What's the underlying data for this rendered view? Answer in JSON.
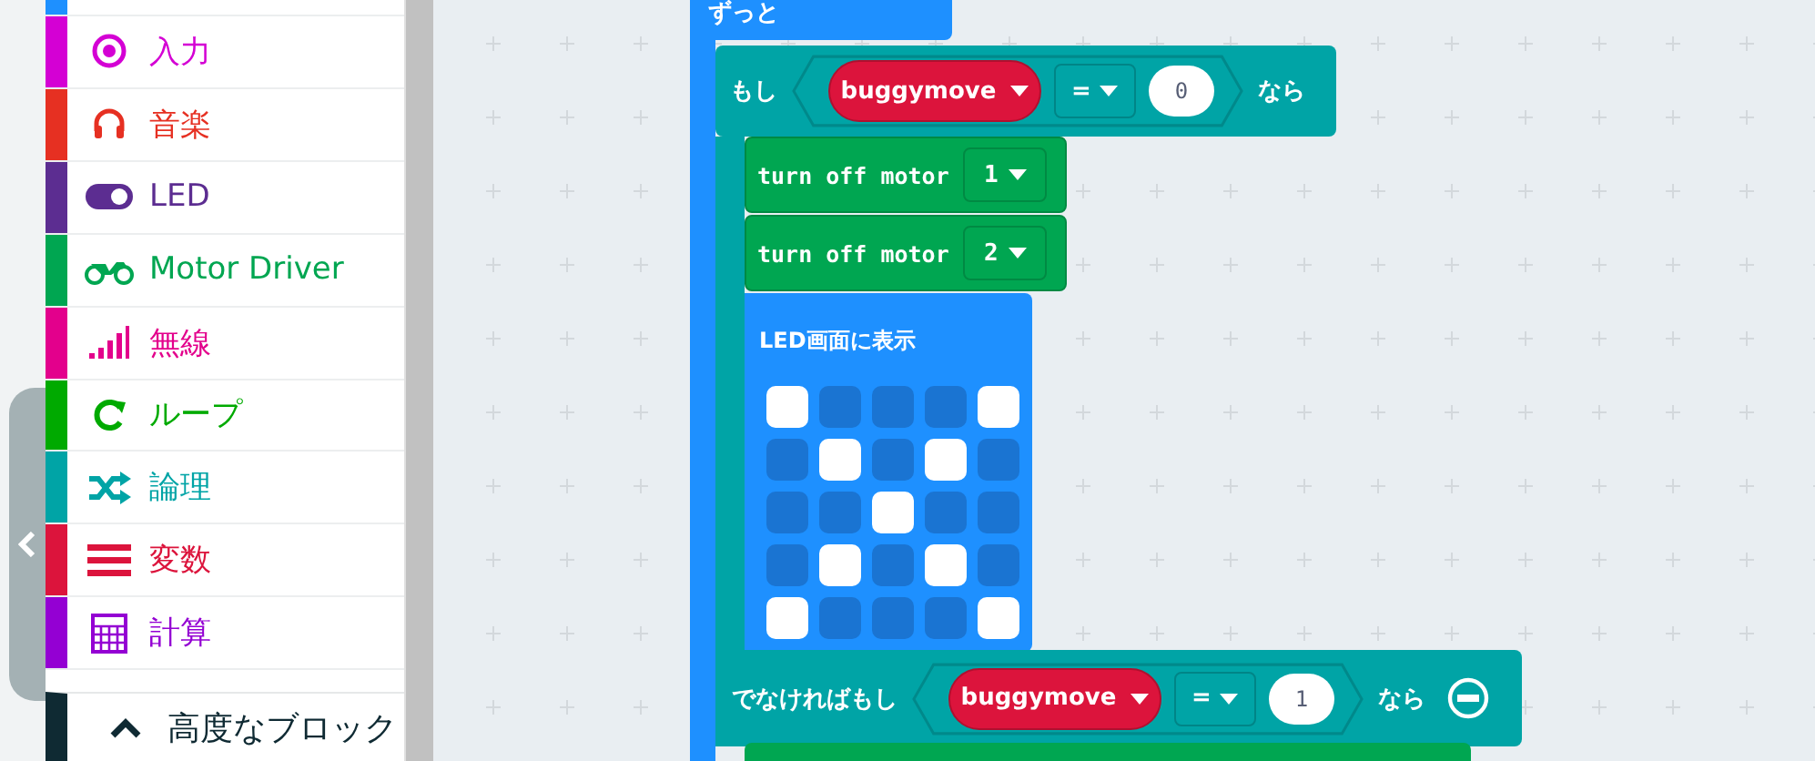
{
  "toolbox": {
    "categories": [
      {
        "kind": "partial",
        "color": "#1e90ff"
      },
      {
        "kind": "input",
        "label": "入力",
        "color": "#d400d4"
      },
      {
        "kind": "music",
        "label": "音楽",
        "color": "#e63022"
      },
      {
        "kind": "led",
        "label": "LED",
        "color": "#5c2d91"
      },
      {
        "kind": "motor",
        "label": "Motor Driver",
        "color": "#00a651"
      },
      {
        "kind": "radio",
        "label": "無線",
        "color": "#e3008c"
      },
      {
        "kind": "loop",
        "label": "ループ",
        "color": "#00aa00"
      },
      {
        "kind": "logic",
        "label": "論理",
        "color": "#00a4a6"
      },
      {
        "kind": "variable",
        "label": "変数",
        "color": "#dc143c"
      },
      {
        "kind": "math",
        "label": "計算",
        "color": "#9400d3"
      }
    ],
    "advanced": {
      "label": "高度なブロック"
    }
  },
  "workspace": {
    "forever": {
      "label": "ずっと"
    },
    "if_block": {
      "keyword": "もし",
      "variable": "buggymove",
      "operator": "=",
      "value": "0",
      "then": "なら"
    },
    "body": [
      {
        "kind": "motor",
        "label": "turn off motor",
        "option": "1"
      },
      {
        "kind": "motor",
        "label": "turn off motor",
        "option": "2"
      },
      {
        "kind": "led",
        "label": "LED画面に表示",
        "leds": [
          [
            {
              "on": true
            },
            {
              "on": false
            },
            {
              "on": false
            },
            {
              "on": false
            },
            {
              "on": true
            }
          ],
          [
            {
              "on": false
            },
            {
              "on": true
            },
            {
              "on": false
            },
            {
              "on": true
            },
            {
              "on": false
            }
          ],
          [
            {
              "on": false
            },
            {
              "on": false
            },
            {
              "on": true
            },
            {
              "on": false
            },
            {
              "on": false
            }
          ],
          [
            {
              "on": false
            },
            {
              "on": true
            },
            {
              "on": false
            },
            {
              "on": true
            },
            {
              "on": false
            }
          ],
          [
            {
              "on": true
            },
            {
              "on": false
            },
            {
              "on": false
            },
            {
              "on": false
            },
            {
              "on": true
            }
          ]
        ]
      }
    ],
    "else_if": {
      "keyword": "でなければもし",
      "variable": "buggymove",
      "operator": "=",
      "value": "1",
      "then": "なら"
    }
  }
}
